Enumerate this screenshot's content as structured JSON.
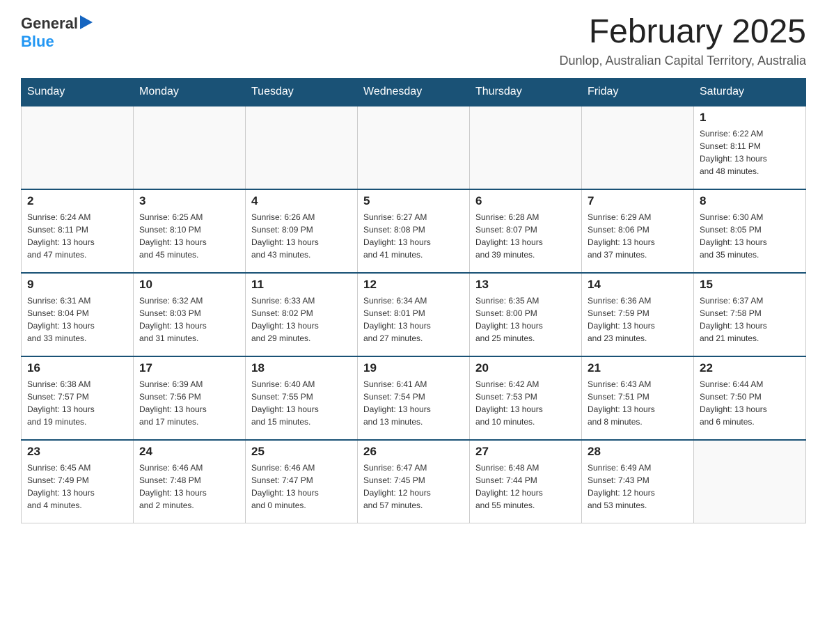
{
  "header": {
    "logo_text_general": "General",
    "logo_text_blue": "Blue",
    "month_title": "February 2025",
    "location": "Dunlop, Australian Capital Territory, Australia"
  },
  "weekdays": [
    "Sunday",
    "Monday",
    "Tuesday",
    "Wednesday",
    "Thursday",
    "Friday",
    "Saturday"
  ],
  "weeks": [
    [
      {
        "day": "",
        "info": ""
      },
      {
        "day": "",
        "info": ""
      },
      {
        "day": "",
        "info": ""
      },
      {
        "day": "",
        "info": ""
      },
      {
        "day": "",
        "info": ""
      },
      {
        "day": "",
        "info": ""
      },
      {
        "day": "1",
        "info": "Sunrise: 6:22 AM\nSunset: 8:11 PM\nDaylight: 13 hours\nand 48 minutes."
      }
    ],
    [
      {
        "day": "2",
        "info": "Sunrise: 6:24 AM\nSunset: 8:11 PM\nDaylight: 13 hours\nand 47 minutes."
      },
      {
        "day": "3",
        "info": "Sunrise: 6:25 AM\nSunset: 8:10 PM\nDaylight: 13 hours\nand 45 minutes."
      },
      {
        "day": "4",
        "info": "Sunrise: 6:26 AM\nSunset: 8:09 PM\nDaylight: 13 hours\nand 43 minutes."
      },
      {
        "day": "5",
        "info": "Sunrise: 6:27 AM\nSunset: 8:08 PM\nDaylight: 13 hours\nand 41 minutes."
      },
      {
        "day": "6",
        "info": "Sunrise: 6:28 AM\nSunset: 8:07 PM\nDaylight: 13 hours\nand 39 minutes."
      },
      {
        "day": "7",
        "info": "Sunrise: 6:29 AM\nSunset: 8:06 PM\nDaylight: 13 hours\nand 37 minutes."
      },
      {
        "day": "8",
        "info": "Sunrise: 6:30 AM\nSunset: 8:05 PM\nDaylight: 13 hours\nand 35 minutes."
      }
    ],
    [
      {
        "day": "9",
        "info": "Sunrise: 6:31 AM\nSunset: 8:04 PM\nDaylight: 13 hours\nand 33 minutes."
      },
      {
        "day": "10",
        "info": "Sunrise: 6:32 AM\nSunset: 8:03 PM\nDaylight: 13 hours\nand 31 minutes."
      },
      {
        "day": "11",
        "info": "Sunrise: 6:33 AM\nSunset: 8:02 PM\nDaylight: 13 hours\nand 29 minutes."
      },
      {
        "day": "12",
        "info": "Sunrise: 6:34 AM\nSunset: 8:01 PM\nDaylight: 13 hours\nand 27 minutes."
      },
      {
        "day": "13",
        "info": "Sunrise: 6:35 AM\nSunset: 8:00 PM\nDaylight: 13 hours\nand 25 minutes."
      },
      {
        "day": "14",
        "info": "Sunrise: 6:36 AM\nSunset: 7:59 PM\nDaylight: 13 hours\nand 23 minutes."
      },
      {
        "day": "15",
        "info": "Sunrise: 6:37 AM\nSunset: 7:58 PM\nDaylight: 13 hours\nand 21 minutes."
      }
    ],
    [
      {
        "day": "16",
        "info": "Sunrise: 6:38 AM\nSunset: 7:57 PM\nDaylight: 13 hours\nand 19 minutes."
      },
      {
        "day": "17",
        "info": "Sunrise: 6:39 AM\nSunset: 7:56 PM\nDaylight: 13 hours\nand 17 minutes."
      },
      {
        "day": "18",
        "info": "Sunrise: 6:40 AM\nSunset: 7:55 PM\nDaylight: 13 hours\nand 15 minutes."
      },
      {
        "day": "19",
        "info": "Sunrise: 6:41 AM\nSunset: 7:54 PM\nDaylight: 13 hours\nand 13 minutes."
      },
      {
        "day": "20",
        "info": "Sunrise: 6:42 AM\nSunset: 7:53 PM\nDaylight: 13 hours\nand 10 minutes."
      },
      {
        "day": "21",
        "info": "Sunrise: 6:43 AM\nSunset: 7:51 PM\nDaylight: 13 hours\nand 8 minutes."
      },
      {
        "day": "22",
        "info": "Sunrise: 6:44 AM\nSunset: 7:50 PM\nDaylight: 13 hours\nand 6 minutes."
      }
    ],
    [
      {
        "day": "23",
        "info": "Sunrise: 6:45 AM\nSunset: 7:49 PM\nDaylight: 13 hours\nand 4 minutes."
      },
      {
        "day": "24",
        "info": "Sunrise: 6:46 AM\nSunset: 7:48 PM\nDaylight: 13 hours\nand 2 minutes."
      },
      {
        "day": "25",
        "info": "Sunrise: 6:46 AM\nSunset: 7:47 PM\nDaylight: 13 hours\nand 0 minutes."
      },
      {
        "day": "26",
        "info": "Sunrise: 6:47 AM\nSunset: 7:45 PM\nDaylight: 12 hours\nand 57 minutes."
      },
      {
        "day": "27",
        "info": "Sunrise: 6:48 AM\nSunset: 7:44 PM\nDaylight: 12 hours\nand 55 minutes."
      },
      {
        "day": "28",
        "info": "Sunrise: 6:49 AM\nSunset: 7:43 PM\nDaylight: 12 hours\nand 53 minutes."
      },
      {
        "day": "",
        "info": ""
      }
    ]
  ]
}
